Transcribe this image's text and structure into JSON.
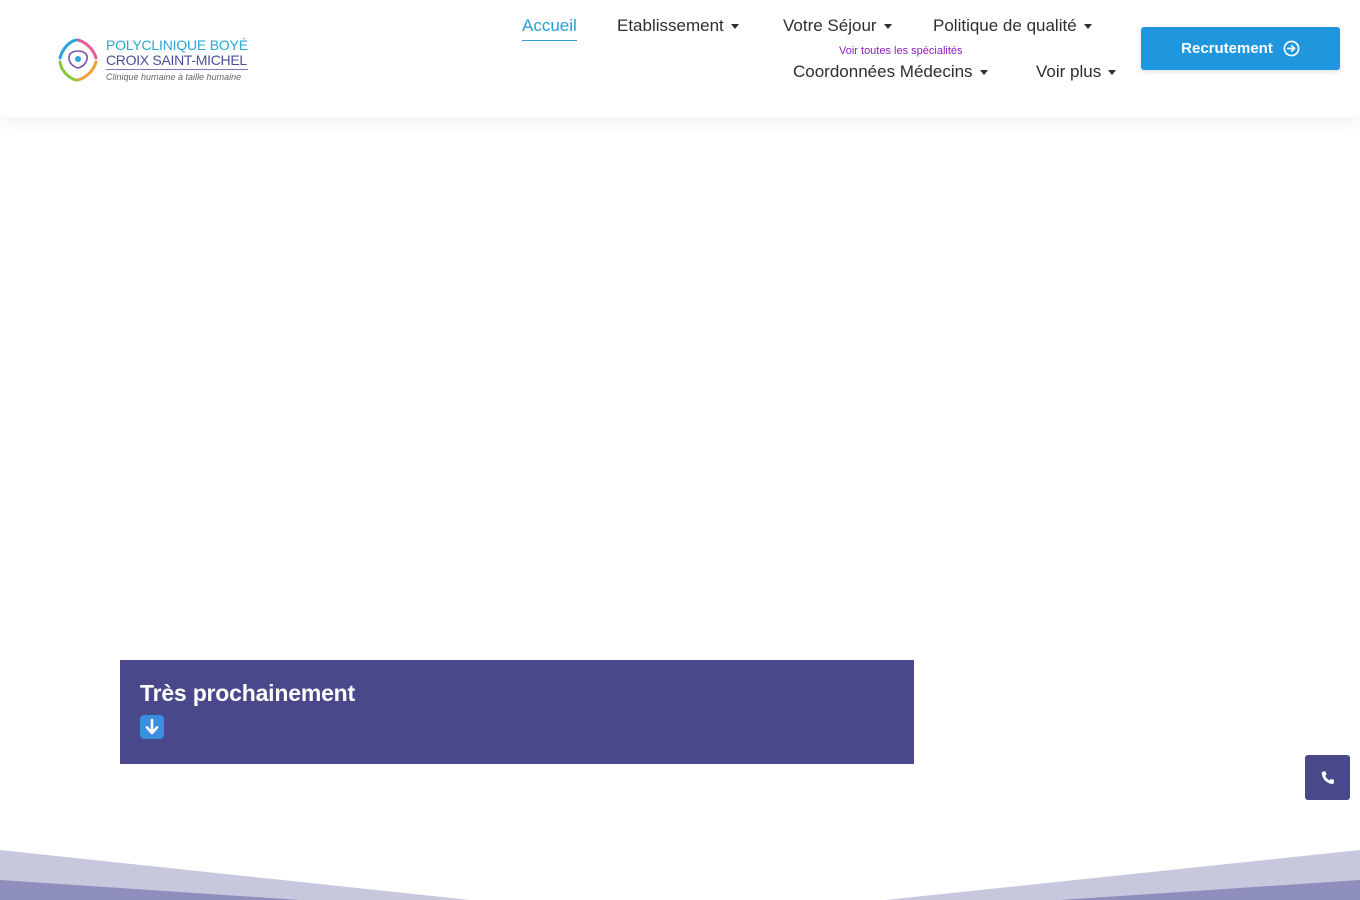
{
  "logo": {
    "line1": "POLYCLINIQUE BOYÉ",
    "line2": "CROIX SAINT-MICHEL",
    "tagline": "Clinique humaine à taille humaine"
  },
  "nav": {
    "accueil": "Accueil",
    "etablissement": "Etablissement",
    "sejour": "Votre Séjour",
    "qualite": "Politique de qualité",
    "specialites_hint": "Voir toutes les spécialités",
    "medecins": "Coordonnées Médecins",
    "voir_plus": "Voir plus"
  },
  "cta": {
    "recrutement": "Recrutement",
    "icon": "arrow-circle-right-icon"
  },
  "notice": {
    "title": "Très prochainement",
    "icon": "down-arrow-emoji-icon"
  },
  "floating": {
    "icon": "phone-icon"
  },
  "colors": {
    "accent": "#2a9fd6",
    "button": "#1f96dd",
    "brand_purple": "#48488a",
    "hint_purple": "#8a1fbf"
  }
}
